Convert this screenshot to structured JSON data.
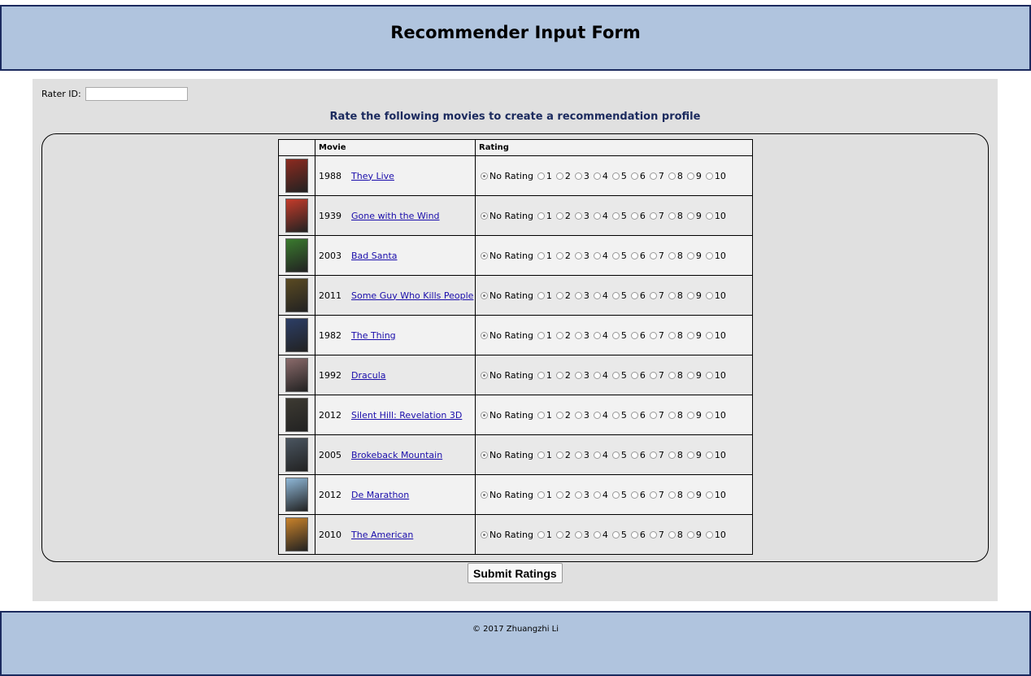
{
  "header": {
    "title": "Recommender Input Form"
  },
  "form": {
    "rater_label": "Rater ID:",
    "rater_value": "",
    "subtitle": "Rate the following movies to create a recommendation profile",
    "columns": {
      "poster": "",
      "movie": "Movie",
      "rating": "Rating"
    },
    "rating_options": [
      "No Rating",
      "1",
      "2",
      "3",
      "4",
      "5",
      "6",
      "7",
      "8",
      "9",
      "10"
    ],
    "movies": [
      {
        "year": "1988",
        "title": "They Live",
        "poster_color": "#8c2a1f",
        "selected": "No Rating"
      },
      {
        "year": "1939",
        "title": "Gone with the Wind",
        "poster_color": "#c43b2a",
        "selected": "No Rating"
      },
      {
        "year": "2003",
        "title": "Bad Santa",
        "poster_color": "#3a7a2e",
        "selected": "No Rating"
      },
      {
        "year": "2011",
        "title": "Some Guy Who Kills People",
        "poster_color": "#5a4a22",
        "selected": "No Rating"
      },
      {
        "year": "1982",
        "title": "The Thing",
        "poster_color": "#2c3e66",
        "selected": "No Rating"
      },
      {
        "year": "1992",
        "title": "Dracula",
        "poster_color": "#8a6a6a",
        "selected": "No Rating"
      },
      {
        "year": "2012",
        "title": "Silent Hill: Revelation 3D",
        "poster_color": "#3d3a32",
        "selected": "No Rating"
      },
      {
        "year": "2005",
        "title": "Brokeback Mountain",
        "poster_color": "#4a5560",
        "selected": "No Rating"
      },
      {
        "year": "2012",
        "title": "De Marathon",
        "poster_color": "#8fb8d8",
        "selected": "No Rating"
      },
      {
        "year": "2010",
        "title": "The American",
        "poster_color": "#c9822a",
        "selected": "No Rating"
      }
    ],
    "submit_label": "Submit Ratings"
  },
  "footer": {
    "copyright": "© 2017 Zhuangzhi Li"
  }
}
